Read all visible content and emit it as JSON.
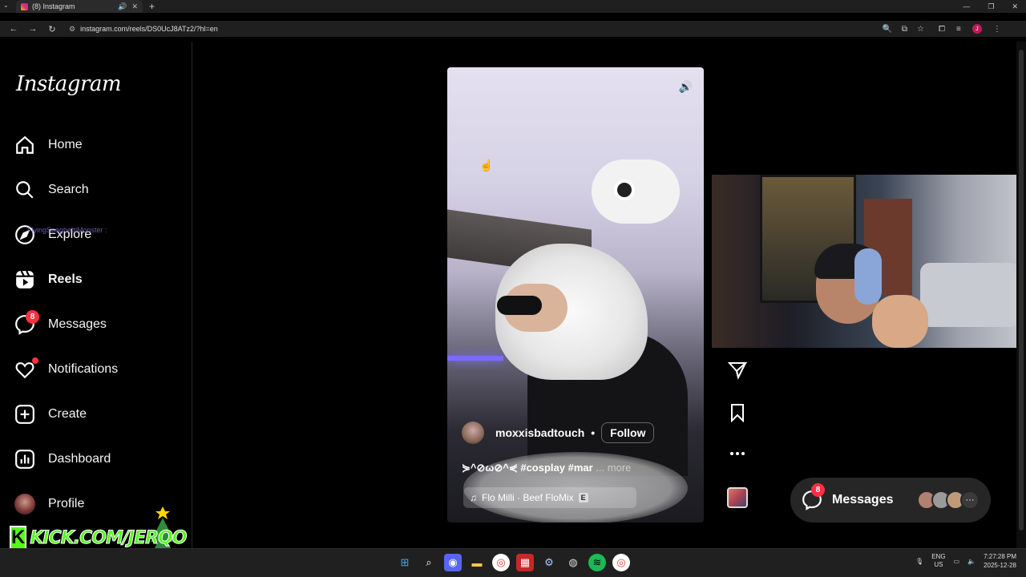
{
  "browser": {
    "tab_title": "(8) Instagram",
    "url": "instagram.com/reels/DS0UcJ8ATz2/?hl=en"
  },
  "sidebar": {
    "logo": "Instagram",
    "items": [
      {
        "label": "Home"
      },
      {
        "label": "Search"
      },
      {
        "label": "Explore"
      },
      {
        "label": "Reels"
      },
      {
        "label": "Messages",
        "badge": "8"
      },
      {
        "label": "Notifications"
      },
      {
        "label": "Create"
      },
      {
        "label": "Dashboard"
      },
      {
        "label": "Profile"
      }
    ],
    "chat_overlay": "FlyingSpaghettiMonster :"
  },
  "stream_banner": {
    "text": "KICK.COM/JERQO",
    "logo_letter": "K"
  },
  "reel": {
    "author": "moxxisbadtouch",
    "follow_label": "Follow",
    "caption": "⋟^⊘ω⊘^⋞ #cosplay #mar",
    "more_label": "... more",
    "music": "Flo Milli · Beef FloMix",
    "explicit_label": "E"
  },
  "messages_pill": {
    "label": "Messages",
    "badge": "8",
    "more": "···"
  },
  "taskbar": {
    "lang_top": "ENG",
    "lang_bottom": "US",
    "time": "7:27:28 PM",
    "date": "2025-12-28"
  },
  "colors": {
    "badge": "#ff3040",
    "kick_green": "#53fc18",
    "background": "#000000"
  }
}
